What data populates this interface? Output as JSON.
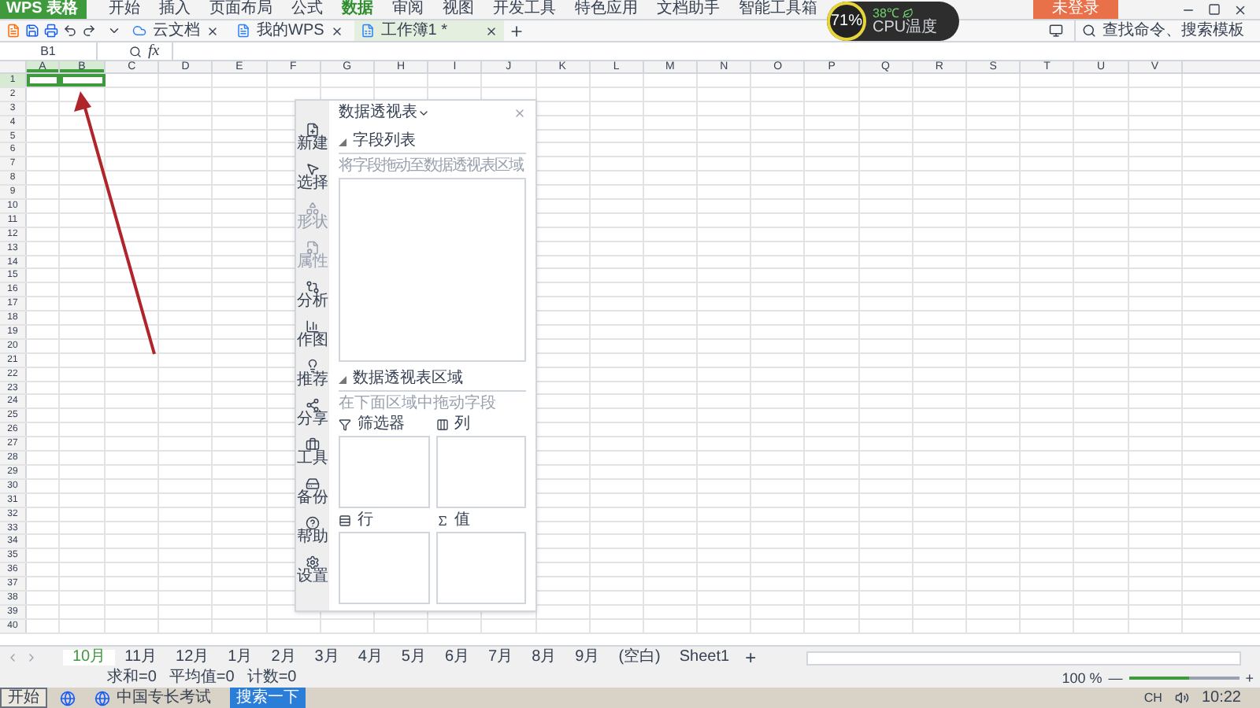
{
  "app_logo": "WPS 表格",
  "menu": [
    {
      "label": "开始",
      "selected": false
    },
    {
      "label": "插入",
      "selected": false
    },
    {
      "label": "页面布局",
      "selected": false
    },
    {
      "label": "公式",
      "selected": false
    },
    {
      "label": "数据",
      "selected": true
    },
    {
      "label": "审阅",
      "selected": false
    },
    {
      "label": "视图",
      "selected": false
    },
    {
      "label": "开发工具",
      "selected": false
    },
    {
      "label": "特色应用",
      "selected": false
    },
    {
      "label": "文档助手",
      "selected": false
    },
    {
      "label": "智能工具箱",
      "selected": false
    }
  ],
  "login": "未登录",
  "cpu": {
    "percent": "71",
    "unit": "%",
    "temp": "38℃",
    "label": "CPU温度"
  },
  "doc_tabs": [
    {
      "label": "云文档",
      "kind": "cloud",
      "selected": false
    },
    {
      "label": "我的WPS",
      "kind": "wps",
      "selected": false
    },
    {
      "label": "工作簿1 *",
      "kind": "sheet",
      "selected": true
    }
  ],
  "search": {
    "placeholder": "查找命令、搜索模板"
  },
  "name_box": "B1",
  "fx": "fx",
  "columns": [
    {
      "label": "A",
      "selected": true
    },
    {
      "label": "B",
      "selected": true
    },
    {
      "label": "C",
      "selected": false
    },
    {
      "label": "D",
      "selected": false
    },
    {
      "label": "E",
      "selected": false
    },
    {
      "label": "F",
      "selected": false
    },
    {
      "label": "G",
      "selected": false
    },
    {
      "label": "H",
      "selected": false
    },
    {
      "label": "I",
      "selected": false
    },
    {
      "label": "J",
      "selected": false
    },
    {
      "label": "K",
      "selected": false
    },
    {
      "label": "L",
      "selected": false
    },
    {
      "label": "M",
      "selected": false
    },
    {
      "label": "N",
      "selected": false
    },
    {
      "label": "O",
      "selected": false
    },
    {
      "label": "P",
      "selected": false
    },
    {
      "label": "Q",
      "selected": false
    },
    {
      "label": "R",
      "selected": false
    },
    {
      "label": "S",
      "selected": false
    },
    {
      "label": "T",
      "selected": false
    },
    {
      "label": "U",
      "selected": false
    },
    {
      "label": "V",
      "selected": false
    }
  ],
  "rows": [
    {
      "label": "1",
      "selected": true
    },
    {
      "label": "2",
      "selected": false
    },
    {
      "label": "3",
      "selected": false
    },
    {
      "label": "4",
      "selected": false
    },
    {
      "label": "5",
      "selected": false
    },
    {
      "label": "6",
      "selected": false
    },
    {
      "label": "7",
      "selected": false
    },
    {
      "label": "8",
      "selected": false
    },
    {
      "label": "9",
      "selected": false
    },
    {
      "label": "10",
      "selected": false
    },
    {
      "label": "11",
      "selected": false
    },
    {
      "label": "12",
      "selected": false
    },
    {
      "label": "13",
      "selected": false
    },
    {
      "label": "14",
      "selected": false
    },
    {
      "label": "15",
      "selected": false
    },
    {
      "label": "16",
      "selected": false
    },
    {
      "label": "17",
      "selected": false
    },
    {
      "label": "18",
      "selected": false
    },
    {
      "label": "19",
      "selected": false
    },
    {
      "label": "20",
      "selected": false
    },
    {
      "label": "21",
      "selected": false
    },
    {
      "label": "22",
      "selected": false
    },
    {
      "label": "23",
      "selected": false
    },
    {
      "label": "24",
      "selected": false
    },
    {
      "label": "25",
      "selected": false
    },
    {
      "label": "26",
      "selected": false
    },
    {
      "label": "27",
      "selected": false
    },
    {
      "label": "28",
      "selected": false
    },
    {
      "label": "29",
      "selected": false
    },
    {
      "label": "30",
      "selected": false
    },
    {
      "label": "31",
      "selected": false
    },
    {
      "label": "32",
      "selected": false
    },
    {
      "label": "33",
      "selected": false
    },
    {
      "label": "34",
      "selected": false
    },
    {
      "label": "35",
      "selected": false
    },
    {
      "label": "36",
      "selected": false
    },
    {
      "label": "37",
      "selected": false
    },
    {
      "label": "38",
      "selected": false
    },
    {
      "label": "39",
      "selected": false
    },
    {
      "label": "40",
      "selected": false
    }
  ],
  "pivot_panel": {
    "title": "数据透视表",
    "tools": [
      {
        "label": "新建",
        "kind": "new",
        "disabled": false
      },
      {
        "label": "选择",
        "kind": "select",
        "disabled": false
      },
      {
        "label": "形状",
        "kind": "shape",
        "disabled": true
      },
      {
        "label": "属性",
        "kind": "props",
        "disabled": true
      },
      {
        "label": "分析",
        "kind": "analyze",
        "disabled": false
      },
      {
        "label": "作图",
        "kind": "chart",
        "disabled": false
      },
      {
        "label": "推荐",
        "kind": "recommend",
        "disabled": false
      },
      {
        "label": "分享",
        "kind": "share",
        "disabled": false
      },
      {
        "label": "工具",
        "kind": "tools",
        "disabled": false
      },
      {
        "label": "备份",
        "kind": "backup",
        "disabled": false
      },
      {
        "label": "帮助",
        "kind": "help",
        "disabled": false
      },
      {
        "label": "设置",
        "kind": "settings",
        "disabled": false
      }
    ],
    "field_list": {
      "heading": "字段列表",
      "hint": "将字段拖动至数据透视表区域"
    },
    "areas_section": {
      "heading": "数据透视表区域",
      "hint": "在下面区域中拖动字段"
    },
    "areas": [
      {
        "label": "筛选器",
        "kind": "filter"
      },
      {
        "label": "列",
        "kind": "columns"
      },
      {
        "label": "行",
        "kind": "rows"
      },
      {
        "label": "值",
        "kind": "values"
      }
    ]
  },
  "sheet_tabs": [
    {
      "label": "10月",
      "selected": true
    },
    {
      "label": "11月",
      "selected": false
    },
    {
      "label": "12月",
      "selected": false
    },
    {
      "label": "1月",
      "selected": false
    },
    {
      "label": "2月",
      "selected": false
    },
    {
      "label": "3月",
      "selected": false
    },
    {
      "label": "4月",
      "selected": false
    },
    {
      "label": "5月",
      "selected": false
    },
    {
      "label": "6月",
      "selected": false
    },
    {
      "label": "7月",
      "selected": false
    },
    {
      "label": "8月",
      "selected": false
    },
    {
      "label": "9月",
      "selected": false
    },
    {
      "label": "(空白)",
      "selected": false
    },
    {
      "label": "Sheet1",
      "selected": false
    }
  ],
  "add_sheet": "+",
  "status": {
    "items": [
      "求和=0",
      "平均值=0",
      "计数=0"
    ],
    "zoom": "100 %",
    "zoom_level": {
      "level": 0.55
    },
    "zoom_minus": "—",
    "zoom_plus": "+"
  },
  "taskbar": {
    "start": "开始",
    "task": "中国专长考试",
    "search_button": "搜索一下",
    "lang": "CH",
    "time": "10:22"
  }
}
